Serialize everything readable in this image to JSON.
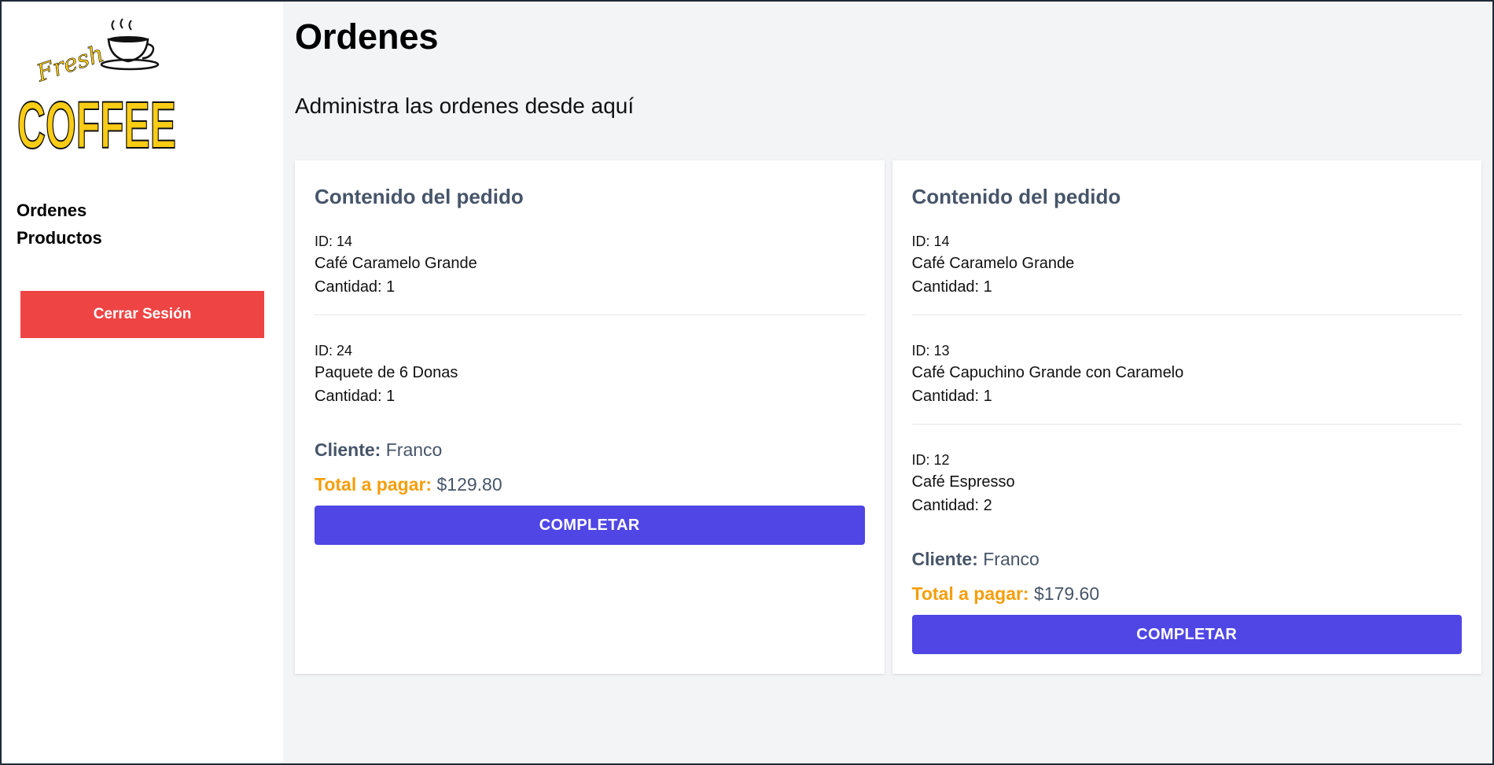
{
  "brand": {
    "logo_top": "Fresh",
    "logo_main": "COFFEE",
    "accent_color": "#facc15"
  },
  "sidebar": {
    "nav": [
      {
        "label": "Ordenes"
      },
      {
        "label": "Productos"
      }
    ],
    "logout_label": "Cerrar Sesión"
  },
  "header": {
    "title": "Ordenes",
    "subtitle": "Administra las ordenes desde aquí"
  },
  "orders": [
    {
      "heading": "Contenido del pedido",
      "items": [
        {
          "id": "ID: 14",
          "name": "Café Caramelo Grande",
          "qty": "Cantidad: 1"
        },
        {
          "id": "ID: 24",
          "name": "Paquete de 6 Donas",
          "qty": "Cantidad: 1"
        }
      ],
      "client_label": "Cliente:",
      "client": "Franco",
      "total_label": "Total a pagar:",
      "total": "$129.80",
      "button": "COMPLETAR"
    },
    {
      "heading": "Contenido del pedido",
      "items": [
        {
          "id": "ID: 14",
          "name": "Café Caramelo Grande",
          "qty": "Cantidad: 1"
        },
        {
          "id": "ID: 13",
          "name": "Café Capuchino Grande con Caramelo",
          "qty": "Cantidad: 1"
        },
        {
          "id": "ID: 12",
          "name": "Café Espresso",
          "qty": "Cantidad: 2"
        }
      ],
      "client_label": "Cliente:",
      "client": "Franco",
      "total_label": "Total a pagar:",
      "total": "$179.60",
      "button": "COMPLETAR"
    }
  ],
  "colors": {
    "logout": "#ef4444",
    "primary": "#4f46e5",
    "total_label": "#f59e0b"
  }
}
